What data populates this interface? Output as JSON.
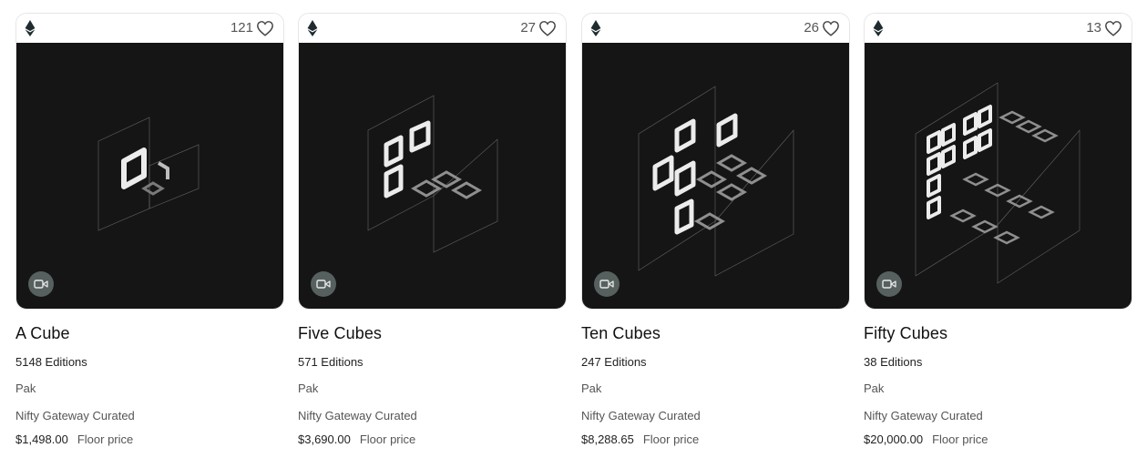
{
  "cards": [
    {
      "title": "A Cube",
      "likes": "121",
      "editions": "5148 Editions",
      "artist": "Pak",
      "curation": "Nifty Gateway Curated",
      "price": "$1,498.00",
      "price_label": "Floor price",
      "chain_icon": "ethereum-icon",
      "media_type": "video"
    },
    {
      "title": "Five Cubes",
      "likes": "27",
      "editions": "571 Editions",
      "artist": "Pak",
      "curation": "Nifty Gateway Curated",
      "price": "$3,690.00",
      "price_label": "Floor price",
      "chain_icon": "ethereum-icon",
      "media_type": "video"
    },
    {
      "title": "Ten Cubes",
      "likes": "26",
      "editions": "247 Editions",
      "artist": "Pak",
      "curation": "Nifty Gateway Curated",
      "price": "$8,288.65",
      "price_label": "Floor price",
      "chain_icon": "ethereum-icon",
      "media_type": "video"
    },
    {
      "title": "Fifty Cubes",
      "likes": "13",
      "editions": "38 Editions",
      "artist": "Pak",
      "curation": "Nifty Gateway Curated",
      "price": "$20,000.00",
      "price_label": "Floor price",
      "chain_icon": "ethereum-icon",
      "media_type": "video"
    }
  ],
  "colors": {
    "media_bg": "#151515",
    "video_badge": "#56605e",
    "eth": "#1f2b2e"
  }
}
